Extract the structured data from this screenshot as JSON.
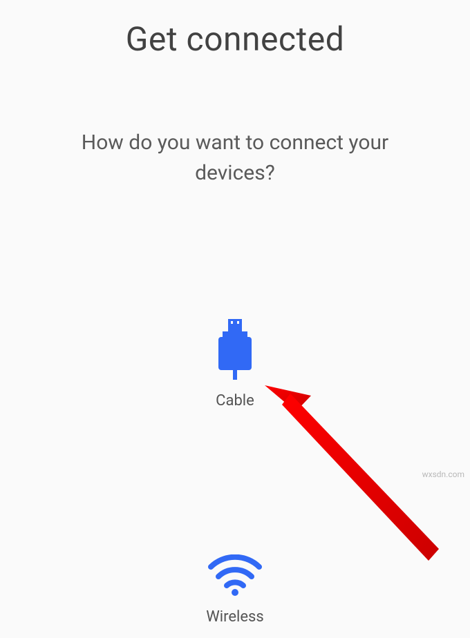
{
  "page": {
    "title": "Get connected",
    "subtitle": "How do you want to connect your devices?"
  },
  "options": {
    "cable": {
      "label": "Cable"
    },
    "wireless": {
      "label": "Wireless"
    }
  },
  "icons": {
    "cable_color": "#3169f5",
    "wifi_color": "#3169f5"
  },
  "annotation": {
    "arrow_color": "#ff0000"
  },
  "watermark": "wxsdn.com"
}
